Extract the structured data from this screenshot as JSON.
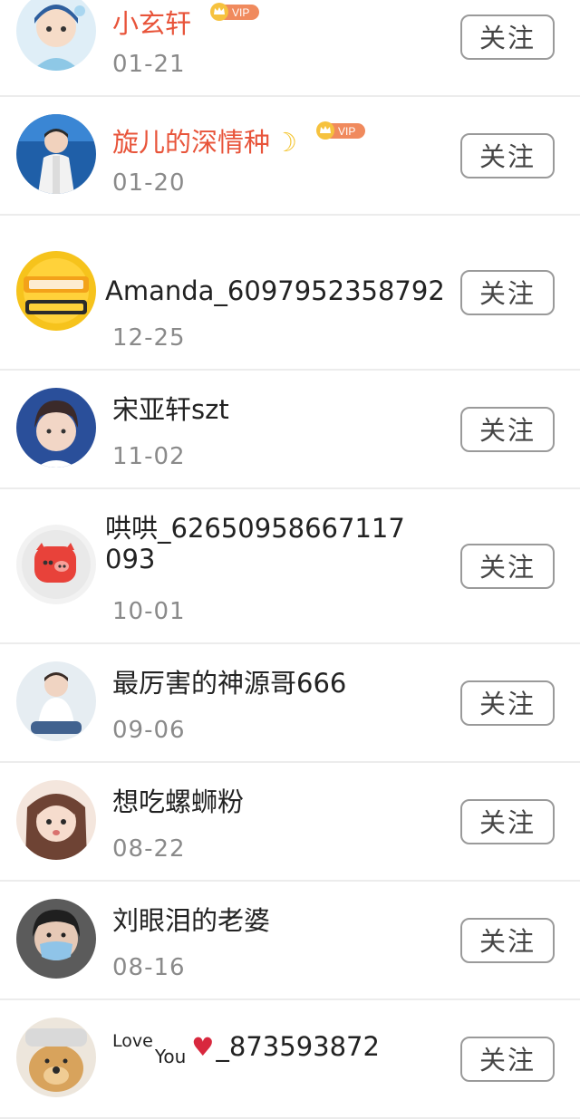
{
  "follow_label": "关注",
  "vip_badge": "VIP",
  "rows": [
    {
      "name": "小玄轩",
      "date": "01-21",
      "vip": true,
      "avatar": "cartoon-boy-avatar"
    },
    {
      "name": "旋儿的深情种",
      "date": "01-20",
      "vip": true,
      "avatar": "boy-on-stage-avatar",
      "emoji": "moon"
    },
    {
      "name": "Amanda_6097952358792",
      "date": "12-25",
      "vip": false,
      "avatar": "yellow-logo-avatar"
    },
    {
      "name": "宋亚轩szt",
      "date": "11-02",
      "vip": false,
      "avatar": "boy-portrait-avatar"
    },
    {
      "name": "哄哄_62650958667117093",
      "date": "10-01",
      "vip": false,
      "avatar": "pig-avatar"
    },
    {
      "name": "最厉害的神源哥666",
      "date": "09-06",
      "vip": false,
      "avatar": "boy-sitting-avatar"
    },
    {
      "name": "想吃螺蛳粉",
      "date": "08-22",
      "vip": false,
      "avatar": "girl-portrait-avatar"
    },
    {
      "name": "刘眼泪的老婆",
      "date": "08-16",
      "vip": false,
      "avatar": "masked-boy-avatar"
    },
    {
      "name_prefix_1": "Love",
      "name_prefix_2": "You",
      "name_suffix": "_873593872",
      "date": "",
      "vip": false,
      "avatar": "dog-avatar",
      "emoji": "two-hearts"
    }
  ],
  "colors": {
    "vip_name": "#e8543a",
    "date_text": "#8a8a8a",
    "button_border": "#9a9a9a",
    "divider": "#ececec",
    "vip_badge_bg": "#f08a5d"
  }
}
